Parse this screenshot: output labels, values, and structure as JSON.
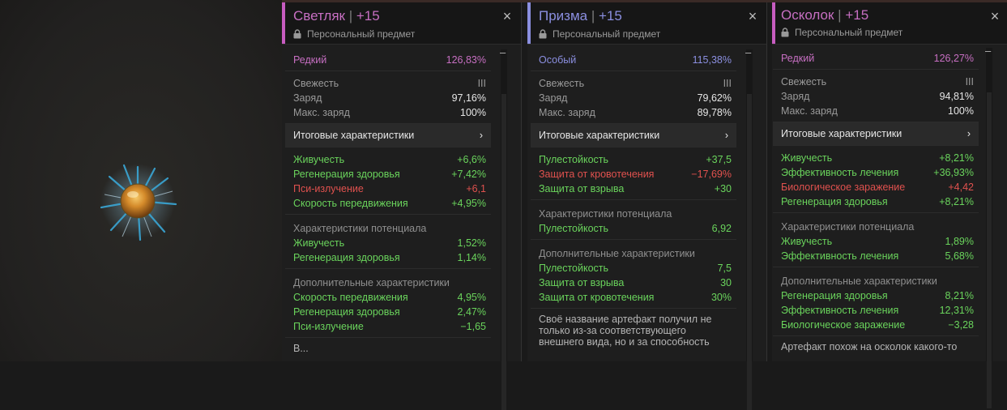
{
  "panels": [
    {
      "name": "Светляк",
      "level": "+15",
      "accent": "#c75cc0",
      "personal": "Персональный предмет",
      "rarity": {
        "label": "Редкий",
        "value": "126,83%",
        "color": "#c76fc2"
      },
      "condition": [
        {
          "label": "Свежесть",
          "value": "III"
        },
        {
          "label": "Заряд",
          "value": "97,16%"
        },
        {
          "label": "Макс. заряд",
          "value": "100%"
        }
      ],
      "summary_label": "Итоговые характеристики",
      "summary_arrow": "›",
      "stats": [
        {
          "label": "Живучесть",
          "value": "+6,6%",
          "tone": "g"
        },
        {
          "label": "Регенерация здоровья",
          "value": "+7,42%",
          "tone": "g"
        },
        {
          "label": "Пси-излучение",
          "value": "+6,1",
          "tone": "r"
        },
        {
          "label": "Скорость передвижения",
          "value": "+4,95%",
          "tone": "g"
        }
      ],
      "potential_header": "Характеристики потенциала",
      "potential": [
        {
          "label": "Живучесть",
          "value": "1,52%",
          "tone": "g"
        },
        {
          "label": "Регенерация здоровья",
          "value": "1,14%",
          "tone": "g"
        }
      ],
      "extra_header": "Дополнительные характеристики",
      "extra": [
        {
          "label": "Скорость передвижения",
          "value": "4,95%",
          "tone": "g"
        },
        {
          "label": "Регенерация здоровья",
          "value": "2,47%",
          "tone": "g"
        },
        {
          "label": "Пси-излучение",
          "value": "−1,65",
          "tone": "g"
        }
      ],
      "description": "В..."
    },
    {
      "name": "Призма",
      "level": "+15",
      "accent": "#8b8fe0",
      "personal": "Персональный предмет",
      "rarity": {
        "label": "Особый",
        "value": "115,38%",
        "color": "#8b8fe0"
      },
      "condition": [
        {
          "label": "Свежесть",
          "value": "III"
        },
        {
          "label": "Заряд",
          "value": "79,62%"
        },
        {
          "label": "Макс. заряд",
          "value": "89,78%"
        }
      ],
      "summary_label": "Итоговые характеристики",
      "summary_arrow": "›",
      "stats": [
        {
          "label": "Пулестойкость",
          "value": "+37,5",
          "tone": "g"
        },
        {
          "label": "Защита от кровотечения",
          "value": "−17,69%",
          "tone": "r"
        },
        {
          "label": "Защита от взрыва",
          "value": "+30",
          "tone": "g"
        }
      ],
      "potential_header": "Характеристики потенциала",
      "potential": [
        {
          "label": "Пулестойкость",
          "value": "6,92",
          "tone": "g"
        }
      ],
      "extra_header": "Дополнительные характеристики",
      "extra": [
        {
          "label": "Пулестойкость",
          "value": "7,5",
          "tone": "g"
        },
        {
          "label": "Защита от взрыва",
          "value": "30",
          "tone": "g"
        },
        {
          "label": "Защита от кровотечения",
          "value": "30%",
          "tone": "g"
        }
      ],
      "description": "Своё название артефакт получил не только из-за соответствующего внешнего вида, но и за способность"
    },
    {
      "name": "Осколок",
      "level": "+15",
      "accent": "#c75cc0",
      "personal": "Персональный предмет",
      "rarity": {
        "label": "Редкий",
        "value": "126,27%",
        "color": "#c76fc2"
      },
      "condition": [
        {
          "label": "Свежесть",
          "value": "III"
        },
        {
          "label": "Заряд",
          "value": "94,81%"
        },
        {
          "label": "Макс. заряд",
          "value": "100%"
        }
      ],
      "summary_label": "Итоговые характеристики",
      "summary_arrow": "›",
      "stats": [
        {
          "label": "Живучесть",
          "value": "+8,21%",
          "tone": "g"
        },
        {
          "label": "Эффективность лечения",
          "value": "+36,93%",
          "tone": "g"
        },
        {
          "label": "Биологическое заражение",
          "value": "+4,42",
          "tone": "r"
        },
        {
          "label": "Регенерация здоровья",
          "value": "+8,21%",
          "tone": "g"
        }
      ],
      "potential_header": "Характеристики потенциала",
      "potential": [
        {
          "label": "Живучесть",
          "value": "1,89%",
          "tone": "g"
        },
        {
          "label": "Эффективность лечения",
          "value": "5,68%",
          "tone": "g"
        }
      ],
      "extra_header": "Дополнительные характеристики",
      "extra": [
        {
          "label": "Регенерация здоровья",
          "value": "8,21%",
          "tone": "g"
        },
        {
          "label": "Эффективность лечения",
          "value": "12,31%",
          "tone": "g"
        },
        {
          "label": "Биологическое заражение",
          "value": "−3,28",
          "tone": "g"
        }
      ],
      "description": "Артефакт похож на осколок какого-то"
    }
  ]
}
